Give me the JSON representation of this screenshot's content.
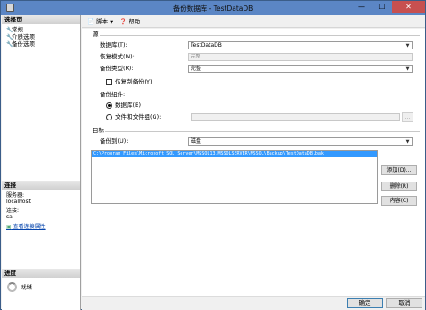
{
  "window": {
    "title": "备份数据库 - TestDataDB",
    "min": "—",
    "max": "☐",
    "close": "✕"
  },
  "sidebar": {
    "header": "选择页",
    "items": [
      {
        "label": "常规"
      },
      {
        "label": "介质选项"
      },
      {
        "label": "备份选项"
      }
    ],
    "connection": {
      "header": "连接",
      "server_label": "服务器:",
      "server_value": "localhost",
      "conn_label": "连接:",
      "conn_value": "sa",
      "view_link": "查看连接属性"
    },
    "progress": {
      "header": "进度",
      "status": "就绪"
    }
  },
  "toolbar": {
    "script_label": "脚本",
    "help_label": "帮助"
  },
  "source": {
    "header": "源",
    "database_label": "数据库(T):",
    "database_value": "TestDataDB",
    "recovery_label": "恢复模式(M):",
    "recovery_value": "完整",
    "backup_type_label": "备份类型(K):",
    "backup_type_value": "完整",
    "copy_only_label": "仅复制备份(Y)",
    "component_label": "备份组件:",
    "comp_database_label": "数据库(B)",
    "comp_files_label": "文件和文件组(G):",
    "browse_label": "..."
  },
  "destination": {
    "header": "目标",
    "backup_to_label": "备份到(U):",
    "backup_to_value": "磁盘",
    "paths": [
      "C:\\Program Files\\Microsoft SQL Server\\MSSQL13.MSSQLSERVER\\MSSQL\\Backup\\TestDataDB.bak"
    ],
    "add_label": "添加(D)...",
    "remove_label": "删除(R)",
    "contents_label": "内容(C)"
  },
  "footer": {
    "ok_label": "确定",
    "cancel_label": "取消"
  }
}
